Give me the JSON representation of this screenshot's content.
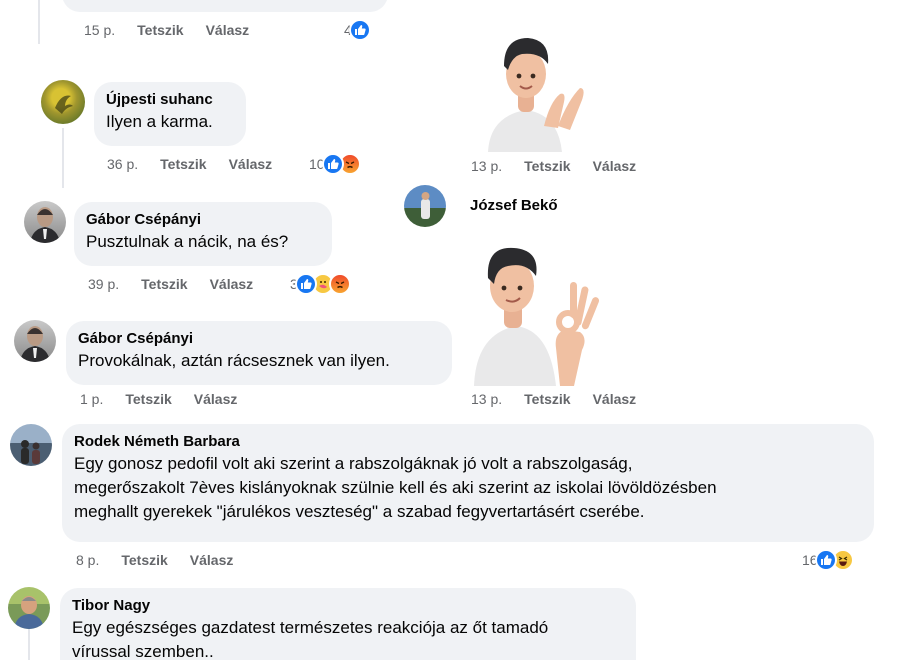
{
  "colors": {
    "like": "#1877f2",
    "angry": "#f04a2a",
    "haha": "#f7c842",
    "bubble": "#f0f2f5",
    "meta": "#65676b"
  },
  "actions": {
    "like": "Tetszik",
    "reply": "Válasz"
  },
  "c0": {
    "time": "15 p.",
    "count": "4",
    "reactions": [
      "like-icon"
    ]
  },
  "c1": {
    "author": "Újpesti suhanc",
    "text": "Ilyen a karma.",
    "time": "36 p.",
    "count": "10",
    "reactions": [
      "like-icon",
      "angry-icon"
    ]
  },
  "c2": {
    "author": "Gábor Csépányi",
    "text": "Pusztulnak a nácik, na és?",
    "time": "39 p.",
    "count": "3",
    "reactions": [
      "like-icon",
      "care-icon",
      "angry-icon"
    ]
  },
  "c3": {
    "author": "Gábor Csépányi",
    "text": "Provokálnak, aztán rácsesznek van ilyen.",
    "time": "1 p."
  },
  "s1": {
    "time": "13 p.",
    "sticker": "clapping-avatar-sticker"
  },
  "jb": {
    "author": "József Bekő"
  },
  "s2": {
    "time": "13 p.",
    "sticker": "ok-hand-avatar-sticker"
  },
  "c4": {
    "author": "Rodek Németh Barbara",
    "lines": [
      "Egy gonosz pedofil volt aki szerint a rabszolgáknak jó volt a rabszolgaság,",
      "megerőszakolt 7èves kislányoknak szülnie kell és aki szerint az iskolai lövöldözésben",
      "meghallt gyerekek \"járulékos veszteség\" a szabad fegyvertartásért cserébe."
    ],
    "time": "8 p.",
    "count": "16",
    "reactions": [
      "like-icon",
      "haha-icon"
    ]
  },
  "c5": {
    "author": "Tibor Nagy",
    "lines": [
      "Egy egészséges gazdatest természetes reakciója az őt tamadó",
      "vírussal szemben.."
    ]
  }
}
